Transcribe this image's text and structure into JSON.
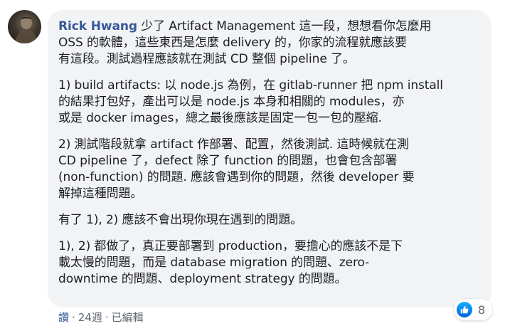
{
  "comment": {
    "author": "Rick Hwang",
    "paragraphs": [
      "少了 Artifact Management 這一段，想想看你怎麼用\nOSS 的軟體，這些東西是怎麼 delivery 的，你家的流程就應該要\n有這段。測試過程應該就在測試 CD 整個 pipeline 了。",
      "1) build artifacts: 以 node.js 為例，在 gitlab-runner 把 npm install\n的結果打包好，產出可以是 node.js 本身和相關的 modules，亦\n或是 docker images，總之最後應該是固定一包一包的壓縮.",
      "2) 測試階段就拿 artifact 作部署、配置，然後測試. 這時候就在測\nCD pipeline 了，defect 除了 function 的問題，也會包含部署\n(non-function) 的問題. 應該會遇到你的問題，然後 developer 要\n解掉這種問題。",
      "有了 1), 2) 應該不會出現你現在遇到的問題。",
      "1), 2) 都做了，真正要部署到 production，要擔心的應該不是下\n載太慢的問題，而是 database migration 的問題、zero-\ndowntime 的問題、deployment strategy 的問題。"
    ]
  },
  "footer": {
    "like_label": "讚",
    "separator": "·",
    "time": "24週",
    "edited": "已編輯"
  },
  "reactions": {
    "icon": "like-icon",
    "count": "8",
    "badge_color": "#1877f2"
  },
  "colors": {
    "author": "#385898",
    "bubble": "#f2f3f5",
    "text": "#1c1e21",
    "meta": "#606770"
  }
}
